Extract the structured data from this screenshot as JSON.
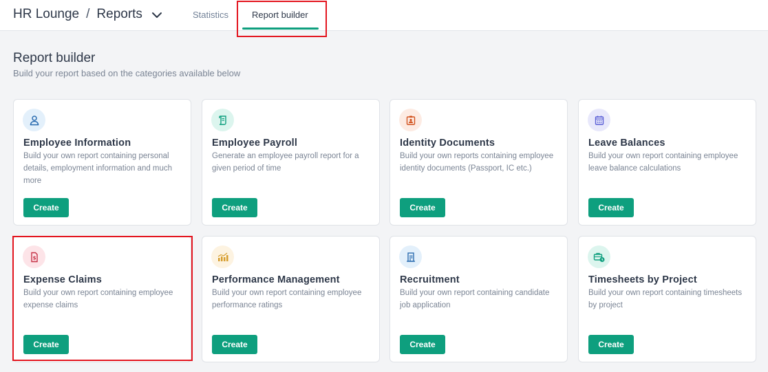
{
  "header": {
    "app_name": "HR Lounge",
    "separator": "/",
    "section": "Reports",
    "tabs": [
      "Statistics",
      "Report builder"
    ]
  },
  "page": {
    "title": "Report builder",
    "subtitle": "Build your report based on the categories available below"
  },
  "cards": [
    {
      "title": "Employee Information",
      "description": "Build your own report containing personal details, employment information and much more",
      "button": "Create",
      "icon": "user-icon",
      "icon_bg": "#e3f0fb",
      "icon_color": "#2b6cb0"
    },
    {
      "title": "Employee Payroll",
      "description": "Generate an employee payroll report for a given period of time",
      "button": "Create",
      "icon": "scroll-icon",
      "icon_bg": "#dcf5ee",
      "icon_color": "#0e9f7e"
    },
    {
      "title": "Identity Documents",
      "description": "Build your own reports containing employee identity documents (Passport, IC etc.)",
      "button": "Create",
      "icon": "id-badge-icon",
      "icon_bg": "#fdebe3",
      "icon_color": "#d2521e"
    },
    {
      "title": "Leave Balances",
      "description": "Build your own report containing employee leave balance calculations",
      "button": "Create",
      "icon": "calendar-icon",
      "icon_bg": "#e8e8fb",
      "icon_color": "#5a5fd6"
    },
    {
      "title": "Expense Claims",
      "description": "Build your own report containing employee expense claims",
      "button": "Create",
      "icon": "receipt-icon",
      "icon_bg": "#fde4e8",
      "icon_color": "#c53045"
    },
    {
      "title": "Performance Management",
      "description": "Build your own report containing employee performance ratings",
      "button": "Create",
      "icon": "bar-chart-icon",
      "icon_bg": "#fdf3e1",
      "icon_color": "#d69e2e"
    },
    {
      "title": "Recruitment",
      "description": "Build your own report containing candidate job application",
      "button": "Create",
      "icon": "building-icon",
      "icon_bg": "#e3f0fb",
      "icon_color": "#2b6cb0"
    },
    {
      "title": "Timesheets by Project",
      "description": "Build your own report containing timesheets by project",
      "button": "Create",
      "icon": "briefcase-clock-icon",
      "icon_bg": "#dcf5ee",
      "icon_color": "#0e9f7e"
    }
  ],
  "colors": {
    "accent": "#0e9f7e",
    "highlight": "#e3141e"
  }
}
